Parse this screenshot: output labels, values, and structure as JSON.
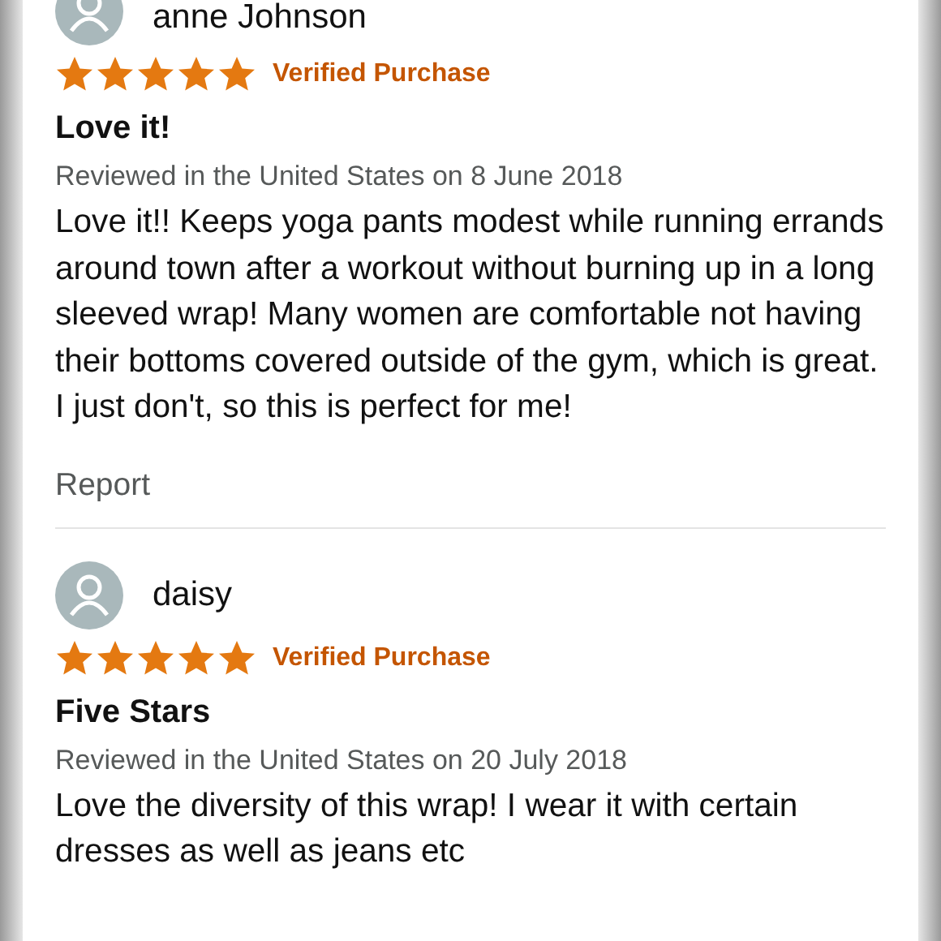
{
  "reviews": [
    {
      "author": "anne Johnson",
      "stars": 5,
      "badge": "Verified Purchase",
      "title": "Love it!",
      "meta": "Reviewed in the United States on 8 June 2018",
      "body": "Love it!! Keeps yoga pants modest while running errands around town after a workout without burning up in a long sleeved wrap! Many women are comfortable not having their bottoms covered outside of the gym, which is great. I just don't, so this is perfect for me!",
      "report": "Report"
    },
    {
      "author": "daisy",
      "stars": 5,
      "badge": "Verified Purchase",
      "title": "Five Stars",
      "meta": "Reviewed in the United States on 20 July 2018",
      "body": "Love the diversity of this wrap! I wear it with certain dresses as well as jeans etc"
    }
  ]
}
